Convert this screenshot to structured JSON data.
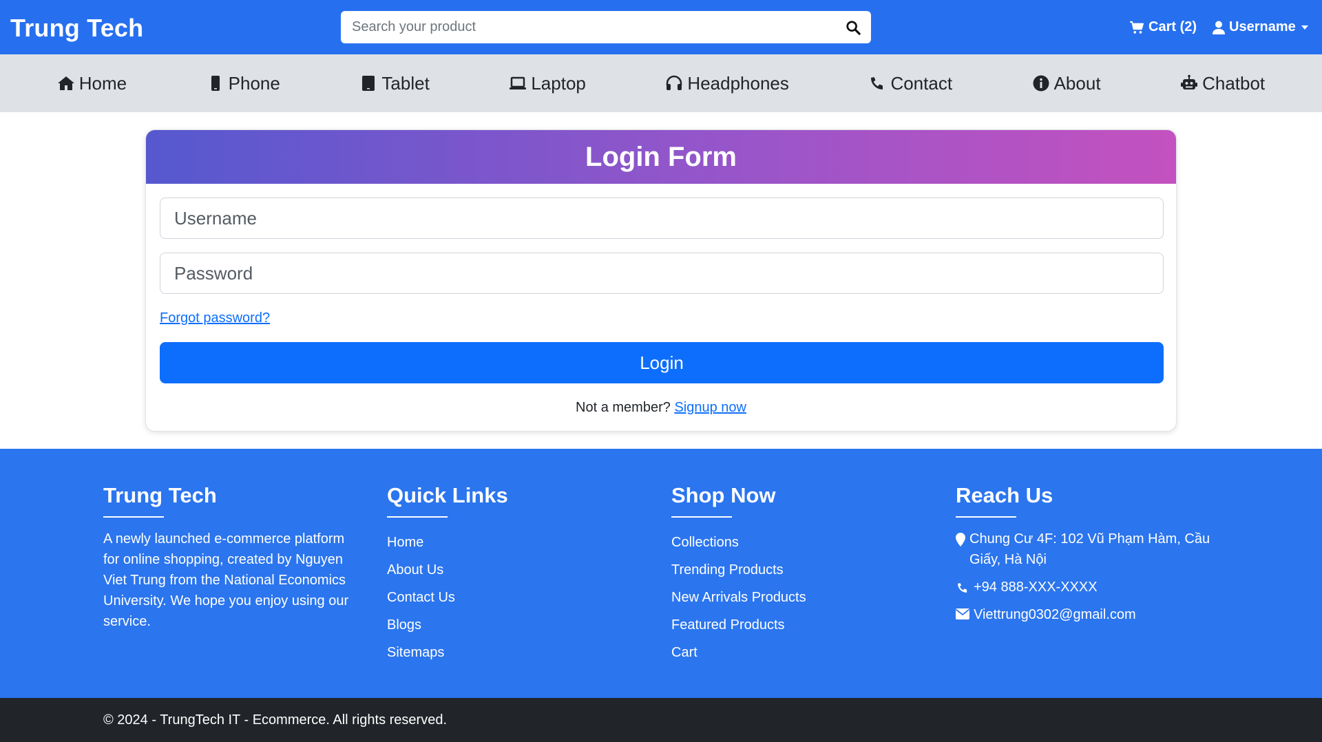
{
  "header": {
    "brand": "Trung Tech",
    "search_placeholder": "Search your product",
    "cart_label": "Cart (2)",
    "user_label": "Username"
  },
  "nav": {
    "items": [
      {
        "label": "Home",
        "icon": "home-icon"
      },
      {
        "label": "Phone",
        "icon": "phone-icon"
      },
      {
        "label": "Tablet",
        "icon": "tablet-icon"
      },
      {
        "label": "Laptop",
        "icon": "laptop-icon"
      },
      {
        "label": "Headphones",
        "icon": "headphones-icon"
      },
      {
        "label": "Contact",
        "icon": "phone-handset-icon"
      },
      {
        "label": "About",
        "icon": "info-icon"
      },
      {
        "label": "Chatbot",
        "icon": "robot-icon"
      }
    ]
  },
  "login": {
    "title": "Login Form",
    "username_placeholder": "Username",
    "password_placeholder": "Password",
    "forgot_label": "Forgot password?",
    "button_label": "Login",
    "member_text": "Not a member?",
    "signup_label": "Signup now"
  },
  "footer": {
    "about": {
      "title": "Trung Tech",
      "text": "A newly launched e-commerce platform for online shopping, created by Nguyen Viet Trung from the National Economics University. We hope you enjoy using our service."
    },
    "quick_links": {
      "title": "Quick Links",
      "items": [
        "Home",
        "About Us",
        "Contact Us",
        "Blogs",
        "Sitemaps"
      ]
    },
    "shop_now": {
      "title": "Shop Now",
      "items": [
        "Collections",
        "Trending Products",
        "New Arrivals Products",
        "Featured Products",
        "Cart"
      ]
    },
    "reach_us": {
      "title": "Reach Us",
      "address": "Chung Cư 4F: 102 Vũ Phạm Hàm, Cầu Giấy, Hà Nội",
      "phone": "+94 888-XXX-XXXX",
      "email": "Viettrung0302@gmail.com"
    }
  },
  "copyright": "© 2024 - TrungTech IT - Ecommerce. All rights reserved.",
  "colors": {
    "header_bg": "#2670f0",
    "nav_bg": "#dee1e5",
    "primary": "#0d6efd",
    "footer_bg": "#2b75ee",
    "copyright_bg": "#212529",
    "gradient_start": "#5658cf",
    "gradient_end": "#c451bf"
  }
}
